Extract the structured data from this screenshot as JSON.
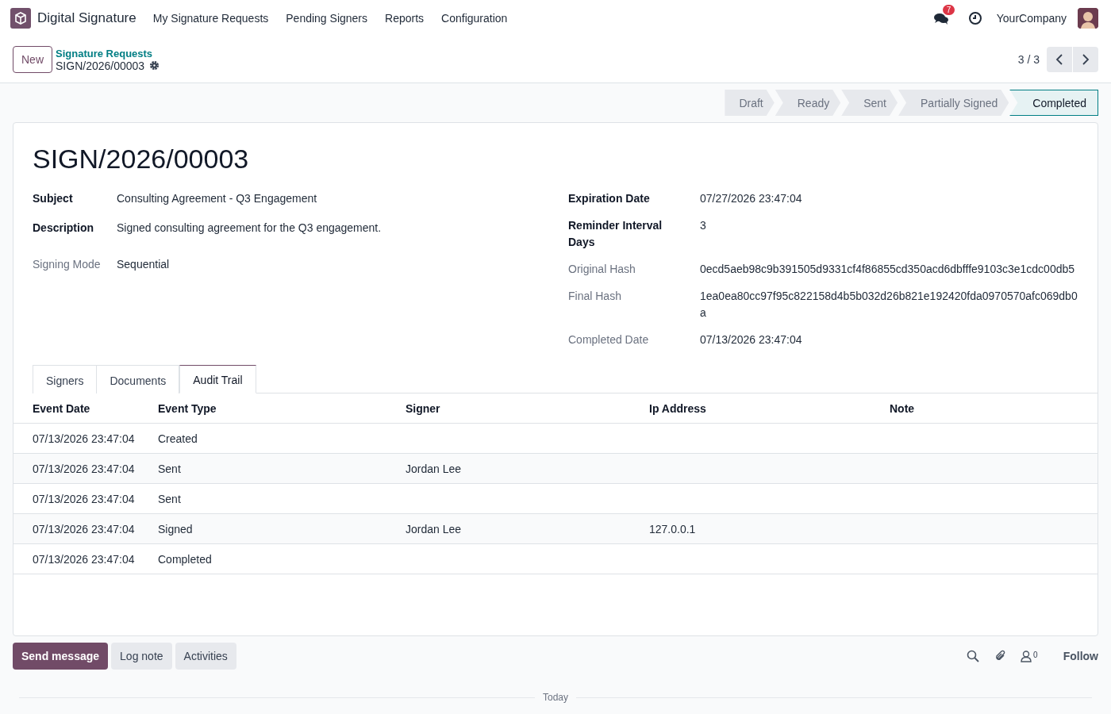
{
  "navbar": {
    "app_name": "Digital Signature",
    "menu": [
      "My Signature Requests",
      "Pending Signers",
      "Reports",
      "Configuration"
    ],
    "message_count": "7",
    "company": "YourCompany"
  },
  "control_panel": {
    "new_button": "New",
    "breadcrumb_parent": "Signature Requests",
    "breadcrumb_current": "SIGN/2026/00003",
    "pager": "3 / 3"
  },
  "statusbar": [
    {
      "label": "Draft",
      "selected": false
    },
    {
      "label": "Ready",
      "selected": false
    },
    {
      "label": "Sent",
      "selected": false
    },
    {
      "label": "Partially Signed",
      "selected": false
    },
    {
      "label": "Completed",
      "selected": true
    }
  ],
  "form": {
    "title": "SIGN/2026/00003",
    "left_groups": [
      [
        {
          "label": "Subject",
          "value": "Consulting Agreement - Q3 Engagement",
          "required": true
        },
        {
          "label": "Description",
          "value": "Signed consulting agreement for the Q3 engagement.",
          "required": true
        }
      ],
      [
        {
          "label": "Signing Mode",
          "value": "Sequential",
          "required": false
        }
      ]
    ],
    "right_fields": [
      {
        "label": "Expiration Date",
        "value": "07/27/2026 23:47:04",
        "required": true
      },
      {
        "label": "Reminder Interval Days",
        "value": "3",
        "required": true
      },
      {
        "label": "Original Hash",
        "value": "0ecd5aeb98c9b391505d9331cf4f86855cd350acd6dbfffe9103c3e1cdc00db5",
        "required": false
      },
      {
        "label": "Final Hash",
        "value": "1ea0ea80cc97f95c822158d4b5b032d26b821e192420fda0970570afc069db0a",
        "required": false
      },
      {
        "label": "Completed Date",
        "value": "07/13/2026 23:47:04",
        "required": false
      }
    ],
    "tabs": [
      {
        "label": "Signers",
        "selected": false
      },
      {
        "label": "Documents",
        "selected": false
      },
      {
        "label": "Audit Trail",
        "selected": true
      }
    ],
    "table": {
      "columns": [
        "Event Date",
        "Event Type",
        "Signer",
        "Ip Address",
        "Note"
      ],
      "rows": [
        [
          "07/13/2026 23:47:04",
          "Created",
          "",
          "",
          ""
        ],
        [
          "07/13/2026 23:47:04",
          "Sent",
          "Jordan Lee",
          "",
          ""
        ],
        [
          "07/13/2026 23:47:04",
          "Sent",
          "",
          "",
          ""
        ],
        [
          "07/13/2026 23:47:04",
          "Signed",
          "Jordan Lee",
          "127.0.0.1",
          ""
        ],
        [
          "07/13/2026 23:47:04",
          "Completed",
          "",
          "",
          ""
        ]
      ]
    }
  },
  "chatter": {
    "buttons": [
      {
        "label": "Send message",
        "kind": "primary"
      },
      {
        "label": "Log note",
        "kind": "secondary"
      },
      {
        "label": "Activities",
        "kind": "secondary"
      }
    ],
    "follower_count": "0",
    "follow": "Follow",
    "date_separator": "Today"
  }
}
